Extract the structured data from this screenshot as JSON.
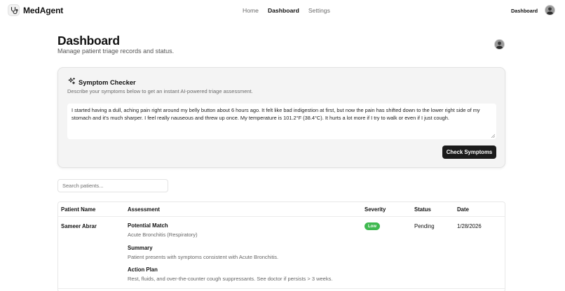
{
  "app": {
    "name": "MedAgent"
  },
  "nav": {
    "items": [
      "Home",
      "Dashboard",
      "Settings"
    ],
    "active": "Dashboard"
  },
  "top_right": {
    "link_label": "Dashboard"
  },
  "header": {
    "title": "Dashboard",
    "subtitle": "Manage patient triage records and status."
  },
  "symptom_checker": {
    "title": "Symptom Checker",
    "description": "Describe your symptoms below to get an instant AI-powered triage assessment.",
    "input_value": "I started having a dull, aching pain right around my belly button about 6 hours ago. It felt like bad indigestion at first, but now the pain has shifted down to the lower right side of my stomach and it's much sharper. I feel really nauseous and threw up once. My temperature is 101.2°F (38.4°C). It hurts a lot more if I try to walk or even if I just cough.",
    "button_label": "Check Symptoms"
  },
  "search": {
    "placeholder": "Search patients..."
  },
  "table": {
    "columns": [
      "Patient Name",
      "Assessment",
      "Severity",
      "Status",
      "Date"
    ],
    "rows": [
      {
        "patient_name": "Sameer Abrar",
        "potential_match_label": "Potential Match",
        "potential_match": "Acute Bronchitis (Respiratory)",
        "summary_label": "Summary",
        "summary": "Patient presents with symptoms consistent with Acute Bronchitis.",
        "action_plan_label": "Action Plan",
        "action_plan": "Rest, fluids, and over-the-counter cough suppressants. See doctor if persists > 3 weeks.",
        "severity": "Low",
        "status": "Pending",
        "date": "1/28/2026"
      }
    ]
  },
  "colors": {
    "severity_low": "#3fb950",
    "primary_button": "#1b1b1b",
    "card_background": "#f4f4f4"
  },
  "icons": {
    "brand": "stethoscope-icon",
    "symptom_checker": "sparkles-icon",
    "avatar": "user-avatar"
  }
}
